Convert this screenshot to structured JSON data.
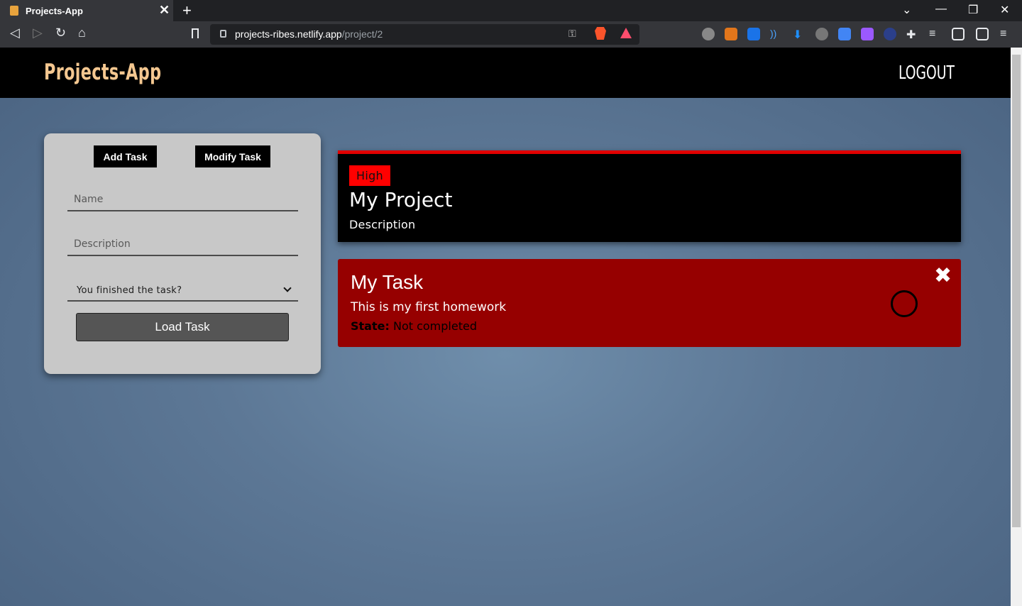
{
  "browser": {
    "tab_title": "Projects-App",
    "url_host": "projects-ribes.netlify.app",
    "url_path": "/project/2"
  },
  "app": {
    "brand": "Projects-App",
    "logout_label": "LOGOUT"
  },
  "task_form": {
    "add_task_label": "Add Task",
    "modify_task_label": "Modify Task",
    "name_placeholder": "Name",
    "description_placeholder": "Description",
    "finished_select_label": "You finished the task?",
    "load_task_label": "Load Task"
  },
  "project": {
    "priority": "High",
    "title": "My Project",
    "description": "Description"
  },
  "tasks": [
    {
      "title": "My Task",
      "description": "This is my first homework",
      "state_label": "State:",
      "state_value": "Not completed"
    }
  ],
  "colors": {
    "brand": "#f4c790",
    "priority_high": "#ff0000",
    "task_card": "#960000"
  }
}
